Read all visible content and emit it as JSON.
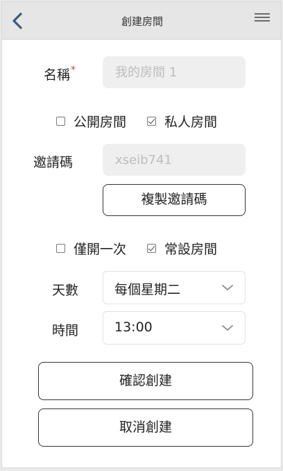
{
  "header": {
    "title": "創建房間",
    "back_icon": "chevron-left-icon",
    "menu_icon": "hamburger-menu-icon"
  },
  "form": {
    "name_label": "名稱",
    "required_mark": "*",
    "name_placeholder": "我的房間 1",
    "visibility": {
      "public_label": "公開房間",
      "public_checked": false,
      "private_label": "私人房間",
      "private_checked": true
    },
    "invite_label": "邀請碼",
    "invite_value": "xseib741",
    "copy_button": "複製邀請碼",
    "schedule": {
      "once_label": "僅開一次",
      "once_checked": false,
      "recurring_label": "常設房間",
      "recurring_checked": true
    },
    "days_label": "天數",
    "days_value": "每個星期二",
    "time_label": "時間",
    "time_value": "13:00",
    "confirm_button": "確認創建",
    "cancel_button": "取消創建"
  },
  "colors": {
    "header_bg": "#e6e6e6",
    "accent_icon": "#3d5a7a",
    "required": "#e0353b",
    "field_bg": "#efefef"
  }
}
